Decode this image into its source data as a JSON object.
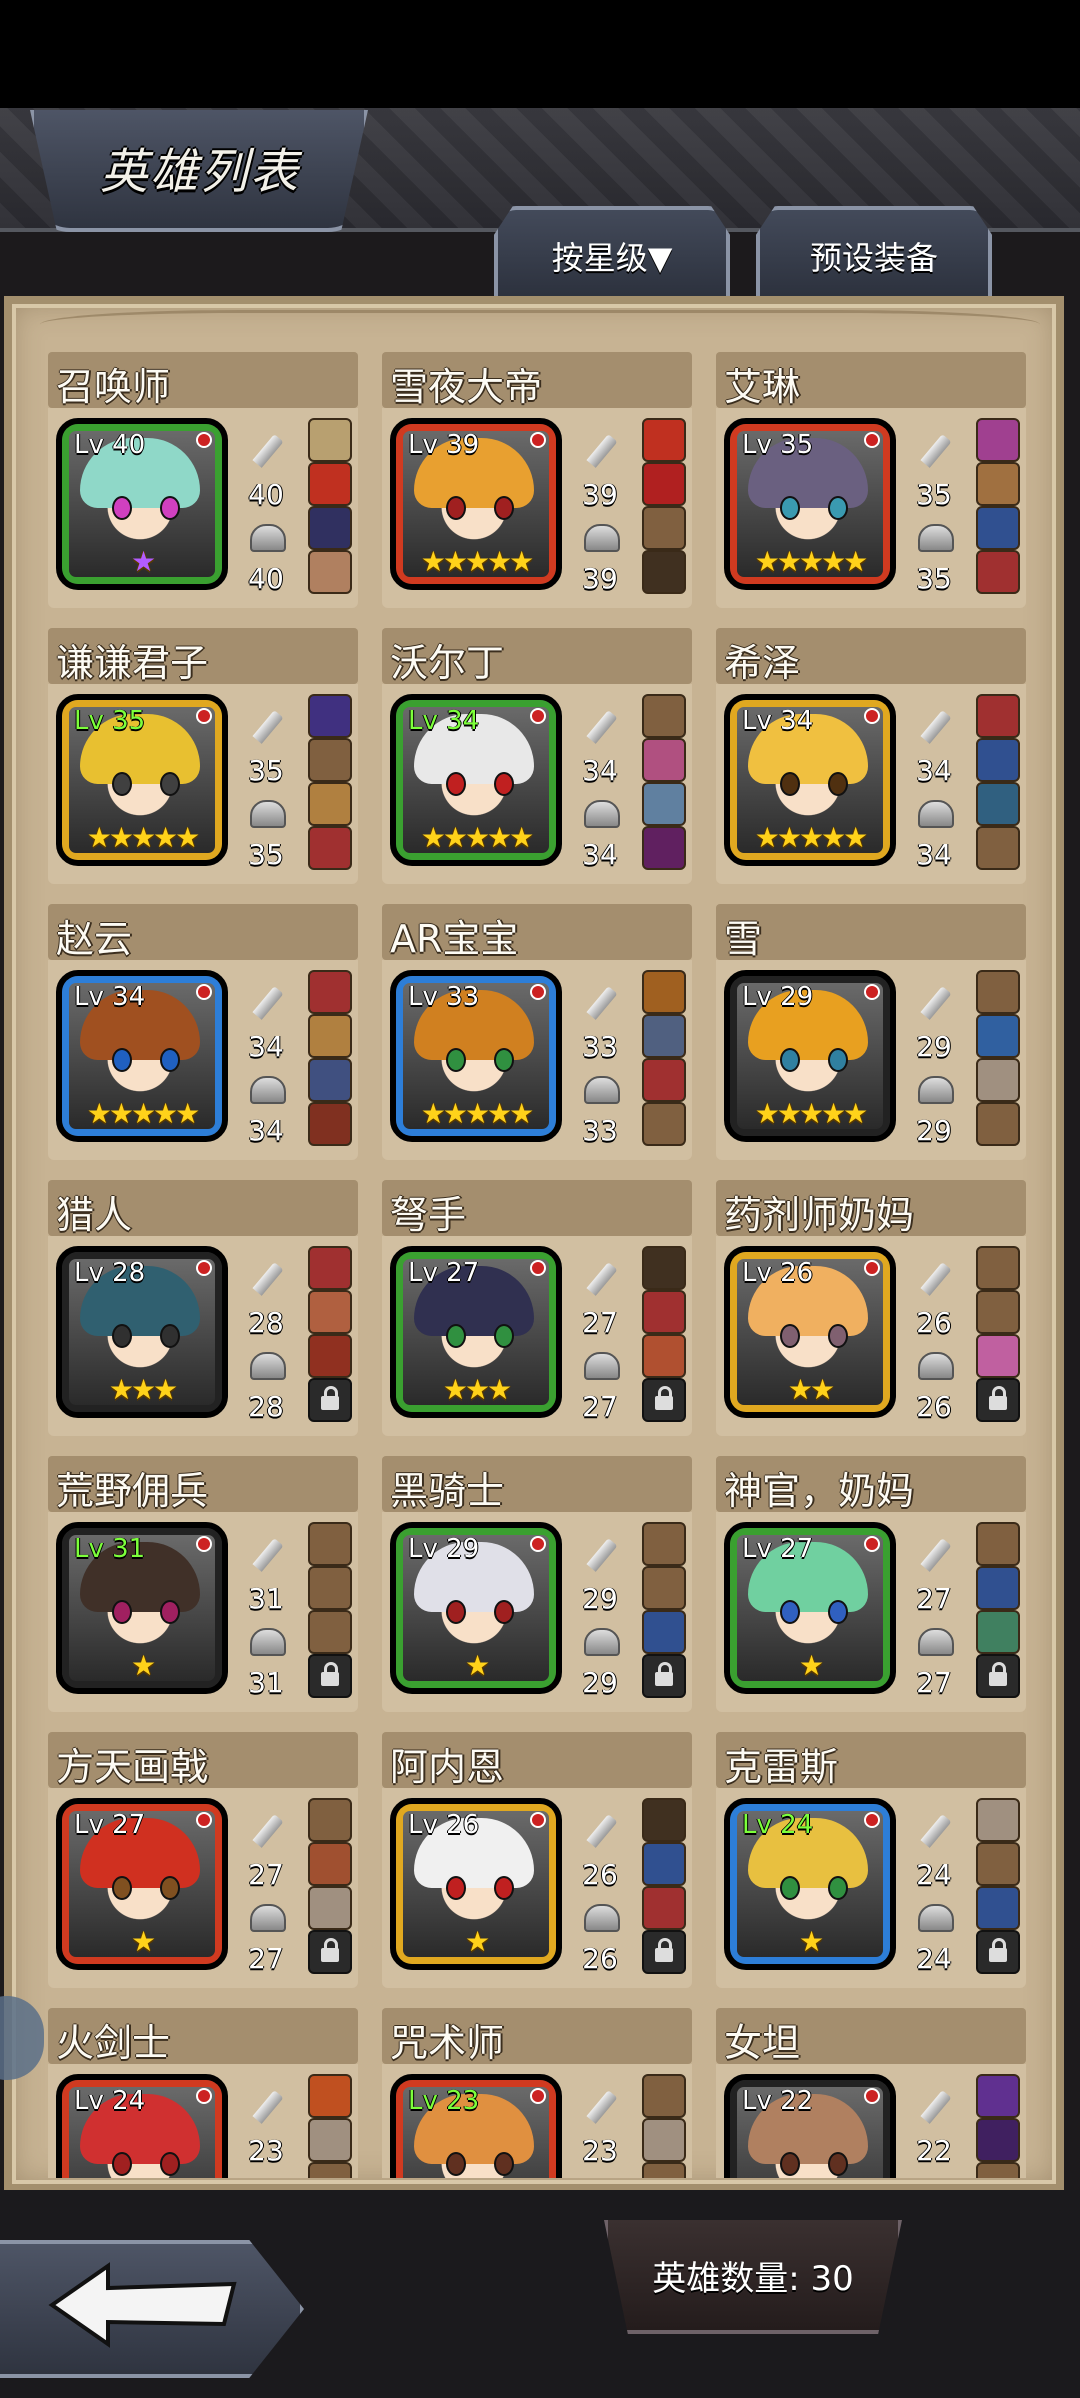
{
  "header": {
    "title": "英雄列表"
  },
  "tabs": {
    "sort": "按星级▼",
    "preset": "预设装备"
  },
  "footer": {
    "count": "英雄数量: 30"
  },
  "heroes": [
    {
      "name": "召唤师",
      "level": "Lv 40",
      "atk": "40",
      "def": "40",
      "frame": "green",
      "hair": "#8fd8c8",
      "eyes": "#d040c0",
      "stars": "★",
      "star_color": "purple",
      "lv_green": false,
      "slots": [
        "#b8a070",
        "#c03020",
        "#303060",
        "#b08060"
      ]
    },
    {
      "name": "雪夜大帝",
      "level": "Lv 39",
      "atk": "39",
      "def": "39",
      "frame": "red",
      "hair": "#e8a030",
      "eyes": "#a02020",
      "stars": "★★★★★",
      "star_color": "gold",
      "lv_green": false,
      "slots": [
        "#c03020",
        "#b02020",
        "#806040",
        "#403020"
      ]
    },
    {
      "name": "艾琳",
      "level": "Lv 35",
      "atk": "35",
      "def": "35",
      "frame": "red",
      "hair": "#6a6080",
      "eyes": "#3a9ab0",
      "stars": "★★★★★",
      "star_color": "gold",
      "lv_green": false,
      "slots": [
        "#a04090",
        "#a07040",
        "#305090",
        "#a03030"
      ]
    },
    {
      "name": "谦谦君子",
      "level": "Lv 35",
      "atk": "35",
      "def": "35",
      "frame": "gold",
      "hair": "#e8c030",
      "eyes": "#404040",
      "stars": "★★★★★",
      "star_color": "gold",
      "lv_green": true,
      "slots": [
        "#403080",
        "#806040",
        "#b08040",
        "#a03030"
      ]
    },
    {
      "name": "沃尔丁",
      "level": "Lv 34",
      "atk": "34",
      "def": "34",
      "frame": "green",
      "hair": "#e8e8e8",
      "eyes": "#c02020",
      "stars": "★★★★★",
      "star_color": "gold",
      "lv_green": true,
      "slots": [
        "#806040",
        "#b05080",
        "#6080a0",
        "#602060"
      ]
    },
    {
      "name": "希泽",
      "level": "Lv 34",
      "atk": "34",
      "def": "34",
      "frame": "gold",
      "hair": "#f0c040",
      "eyes": "#503010",
      "stars": "★★★★★",
      "star_color": "gold",
      "lv_green": false,
      "slots": [
        "#a03030",
        "#305090",
        "#306080",
        "#806040"
      ]
    },
    {
      "name": "赵云",
      "level": "Lv 34",
      "atk": "34",
      "def": "34",
      "frame": "blue",
      "hair": "#a05020",
      "eyes": "#2060c0",
      "stars": "★★★★★",
      "star_color": "gold",
      "lv_green": false,
      "slots": [
        "#a03030",
        "#b08040",
        "#405080",
        "#803020"
      ]
    },
    {
      "name": "AR宝宝",
      "level": "Lv 33",
      "atk": "33",
      "def": "33",
      "frame": "blue",
      "hair": "#d08020",
      "eyes": "#309040",
      "stars": "★★★★★",
      "star_color": "gold",
      "lv_green": false,
      "slots": [
        "#a06020",
        "#506080",
        "#a03030",
        "#806040"
      ]
    },
    {
      "name": "雪",
      "level": "Lv 29",
      "atk": "29",
      "def": "29",
      "frame": "black",
      "hair": "#e8a020",
      "eyes": "#3080a0",
      "stars": "★★★★★",
      "star_color": "gold",
      "lv_green": false,
      "slots": [
        "#806040",
        "#3060a0",
        "#a09080",
        "#806040"
      ]
    },
    {
      "name": "猎人",
      "level": "Lv 28",
      "atk": "28",
      "def": "28",
      "frame": "black",
      "hair": "#306070",
      "eyes": "#303030",
      "stars": "★★★",
      "star_color": "gold",
      "lv_green": false,
      "slots": [
        "#a03030",
        "#b06040",
        "#903020",
        "lock"
      ]
    },
    {
      "name": "弩手",
      "level": "Lv 27",
      "atk": "27",
      "def": "27",
      "frame": "green",
      "hair": "#303050",
      "eyes": "#309040",
      "stars": "★★★",
      "star_color": "gold",
      "lv_green": false,
      "slots": [
        "#403020",
        "#a03030",
        "#b05030",
        "lock"
      ]
    },
    {
      "name": "药剂师奶妈",
      "level": "Lv 26",
      "atk": "26",
      "def": "26",
      "frame": "gold",
      "hair": "#f0b060",
      "eyes": "#806070",
      "stars": "★★",
      "star_color": "gold",
      "lv_green": false,
      "slots": [
        "#806040",
        "#806040",
        "#c060a0",
        "lock"
      ]
    },
    {
      "name": "荒野佣兵",
      "level": "Lv 31",
      "atk": "31",
      "def": "31",
      "frame": "black",
      "hair": "#403028",
      "eyes": "#a02060",
      "stars": "★",
      "star_color": "gold",
      "lv_green": true,
      "slots": [
        "#806040",
        "#806040",
        "#806040",
        "lock"
      ]
    },
    {
      "name": "黑骑士",
      "level": "Lv 29",
      "atk": "29",
      "def": "29",
      "frame": "green",
      "hair": "#e0e0e8",
      "eyes": "#a02020",
      "stars": "★",
      "star_color": "gold",
      "lv_green": false,
      "slots": [
        "#806040",
        "#806040",
        "#305090",
        "lock"
      ]
    },
    {
      "name": "神官，奶妈",
      "level": "Lv 27",
      "atk": "27",
      "def": "27",
      "frame": "green",
      "hair": "#70d0a0",
      "eyes": "#3060c0",
      "stars": "★",
      "star_color": "gold",
      "lv_green": false,
      "slots": [
        "#806040",
        "#305090",
        "#408060",
        "lock"
      ]
    },
    {
      "name": "方天画戟",
      "level": "Lv 27",
      "atk": "27",
      "def": "27",
      "frame": "red",
      "hair": "#d03020",
      "eyes": "#805020",
      "stars": "★",
      "star_color": "gold",
      "lv_green": false,
      "slots": [
        "#806040",
        "#a05030",
        "#a09080",
        "lock"
      ]
    },
    {
      "name": "阿内恩",
      "level": "Lv 26",
      "atk": "26",
      "def": "26",
      "frame": "gold",
      "hair": "#f0f0f0",
      "eyes": "#c02020",
      "stars": "★",
      "star_color": "gold",
      "lv_green": false,
      "slots": [
        "#403020",
        "#305090",
        "#a03030",
        "lock"
      ]
    },
    {
      "name": "克雷斯",
      "level": "Lv 24",
      "atk": "24",
      "def": "24",
      "frame": "blue",
      "hair": "#e8c040",
      "eyes": "#309040",
      "stars": "★",
      "star_color": "gold",
      "lv_green": true,
      "slots": [
        "#a09080",
        "#806040",
        "#305090",
        "lock"
      ]
    },
    {
      "name": "火剑士",
      "level": "Lv 24",
      "atk": "23",
      "def": "",
      "frame": "red",
      "hair": "#d03030",
      "eyes": "#a02020",
      "stars": "",
      "star_color": "gold",
      "lv_green": false,
      "slots": [
        "#c05020",
        "#a09080",
        "#806040",
        "#806040"
      ]
    },
    {
      "name": "咒术师",
      "level": "Lv 23",
      "atk": "23",
      "def": "",
      "frame": "red",
      "hair": "#e09040",
      "eyes": "#603020",
      "stars": "",
      "star_color": "gold",
      "lv_green": true,
      "slots": [
        "#806040",
        "#a09080",
        "#806040",
        "#806040"
      ]
    },
    {
      "name": "女坦",
      "level": "Lv 22",
      "atk": "22",
      "def": "",
      "frame": "black",
      "hair": "#b08060",
      "eyes": "#603020",
      "stars": "",
      "star_color": "gold",
      "lv_green": false,
      "slots": [
        "#603090",
        "#402060",
        "#806040",
        "#806040"
      ]
    }
  ]
}
